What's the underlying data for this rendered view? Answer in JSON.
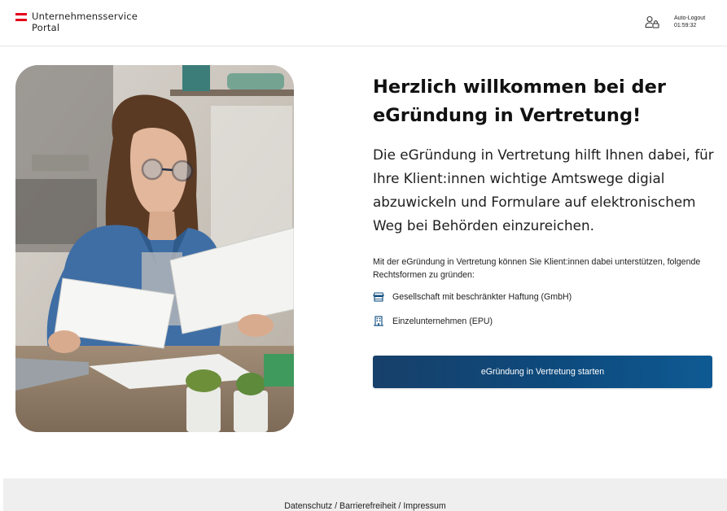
{
  "header": {
    "brand_line1": "Unternehmensservice",
    "brand_line2": "Portal",
    "autologout_label": "Auto-Logout",
    "autologout_time": "01:59:32",
    "user_icon": "user-lock-icon",
    "flag_colors": [
      "#e3001b",
      "#ffffff",
      "#e3001b"
    ]
  },
  "hero": {
    "image": "woman-reviewing-documents-photo"
  },
  "main": {
    "headline_line1": "Herzlich willkommen bei der",
    "headline_line2": "eGründung in Vertretung!",
    "lead": "Die eGründung in Vertretung hilft Ihnen dabei, für Ihre Klient:innen wichtige Amtswege digial abzuwickeln und Formulare auf elektronischem Weg bei Behörden einzureichen.",
    "body": "Mit der eGründung in Vertretung können Sie Klient:innen dabei unterstützen, folgende Rechtsformen zu gründen:",
    "legal_forms": [
      {
        "label": "Gesellschaft mit beschränkter Haftung (GmbH)",
        "icon": "storefront-icon"
      },
      {
        "label": "Einzelunternehmen (EPU)",
        "icon": "building-icon"
      }
    ],
    "cta_label": "eGründung in Vertretung starten",
    "accent_color": "#0d4a7d"
  },
  "footer": {
    "link_privacy": "Datenschutz",
    "link_accessibility": "Barrierefreiheit",
    "link_imprint": "Impressum",
    "separator": " / "
  }
}
